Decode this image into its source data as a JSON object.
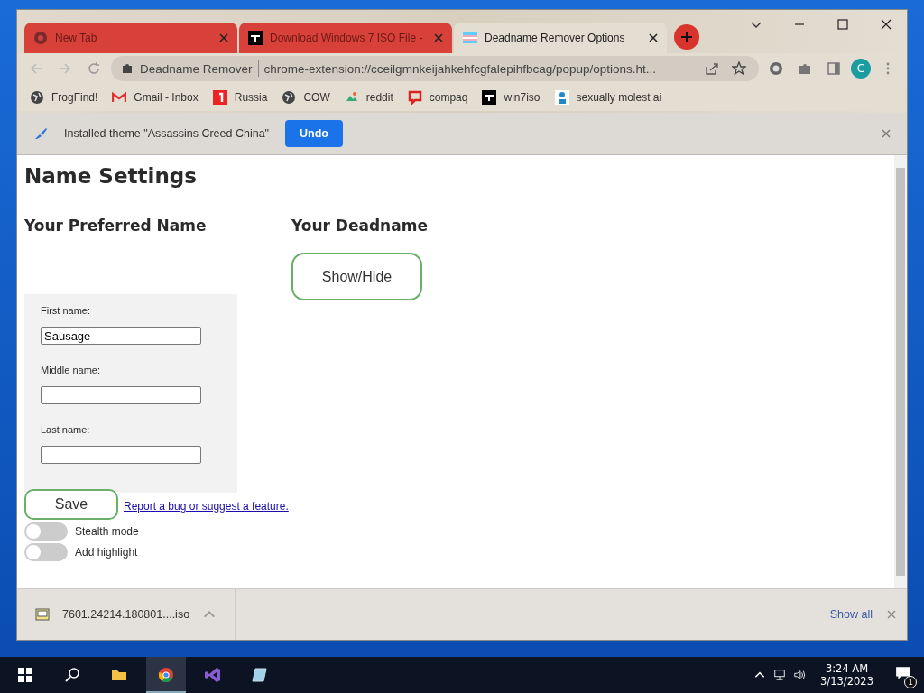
{
  "tabs": [
    {
      "title": "New Tab",
      "selected": false
    },
    {
      "title": "Download Windows 7 ISO File -",
      "selected": false
    },
    {
      "title": "Deadname Remover Options",
      "selected": true
    }
  ],
  "address": {
    "site": "Deadname Remover",
    "url": "chrome-extension://cceilgmnkeijahkehfcgfalepihfbcag/popup/options.ht..."
  },
  "profile": "C",
  "bookmarks": [
    {
      "label": "FrogFind!"
    },
    {
      "label": "Gmail - Inbox"
    },
    {
      "label": "Russia"
    },
    {
      "label": "COW"
    },
    {
      "label": "reddit"
    },
    {
      "label": "compaq"
    },
    {
      "label": "win7iso"
    },
    {
      "label": "sexually molest ai"
    }
  ],
  "infobar": {
    "message": "Installed theme \"Assassins Creed China\"",
    "button": "Undo"
  },
  "page": {
    "title": "Name Settings",
    "preferred_heading": "Your Preferred Name",
    "deadname_heading": "Your Deadname",
    "show_hide": "Show/Hide",
    "fields": [
      {
        "label": "First name:",
        "value": "Sausage"
      },
      {
        "label": "Middle name:"
      },
      {
        "label": "Last name:"
      }
    ],
    "save": "Save",
    "link": "Report a bug or suggest a feature.",
    "toggles": [
      {
        "label": "Stealth mode",
        "on": false
      },
      {
        "label": "Add highlight",
        "on": false
      }
    ]
  },
  "download": {
    "file": "7601.24214.180801....iso",
    "show_all": "Show all"
  },
  "taskbar": {
    "time": "3:24 AM",
    "date": "3/13/2023",
    "notifications": "1"
  }
}
